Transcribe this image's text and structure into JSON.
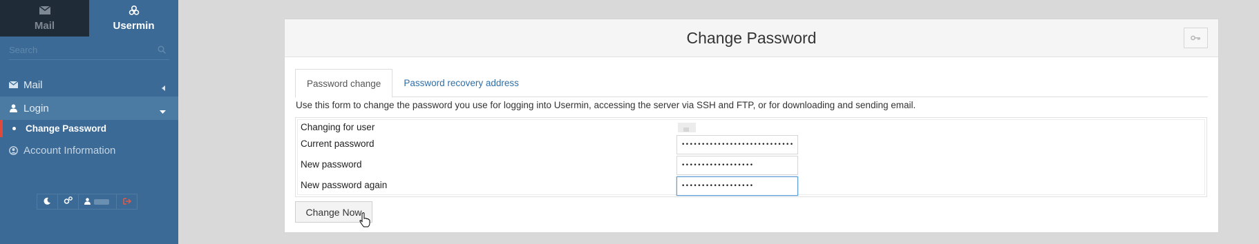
{
  "sidebar": {
    "tabs": [
      {
        "label": "Mail",
        "icon": "envelope-icon"
      },
      {
        "label": "Usermin",
        "icon": "cogs-icon"
      }
    ],
    "search": {
      "placeholder": "Search"
    },
    "menu": {
      "mail": "Mail",
      "login": "Login",
      "change_password": "Change Password",
      "account_info": "Account Information"
    }
  },
  "panel": {
    "title": "Change Password",
    "tabs": {
      "password_change": "Password change",
      "recovery": "Password recovery address"
    },
    "intro": "Use this form to change the password you use for logging into Usermin, accessing the server via SSH and FTP, or for downloading and sending email.",
    "form": {
      "changing_for_user": "Changing for user",
      "current_password": "Current password",
      "new_password": "New password",
      "new_password_again": "New password again",
      "current_value": "••••••••••••••••••••••••••••",
      "new_value": "••••••••••••••••••",
      "again_value": "••••••••••••••••••"
    },
    "submit": "Change Now"
  },
  "colors": {
    "sidebar_bg": "#3a6a95",
    "sidebar_dark": "#1f2b36",
    "active_marker": "#e04a3b",
    "link": "#2f6fa7"
  }
}
